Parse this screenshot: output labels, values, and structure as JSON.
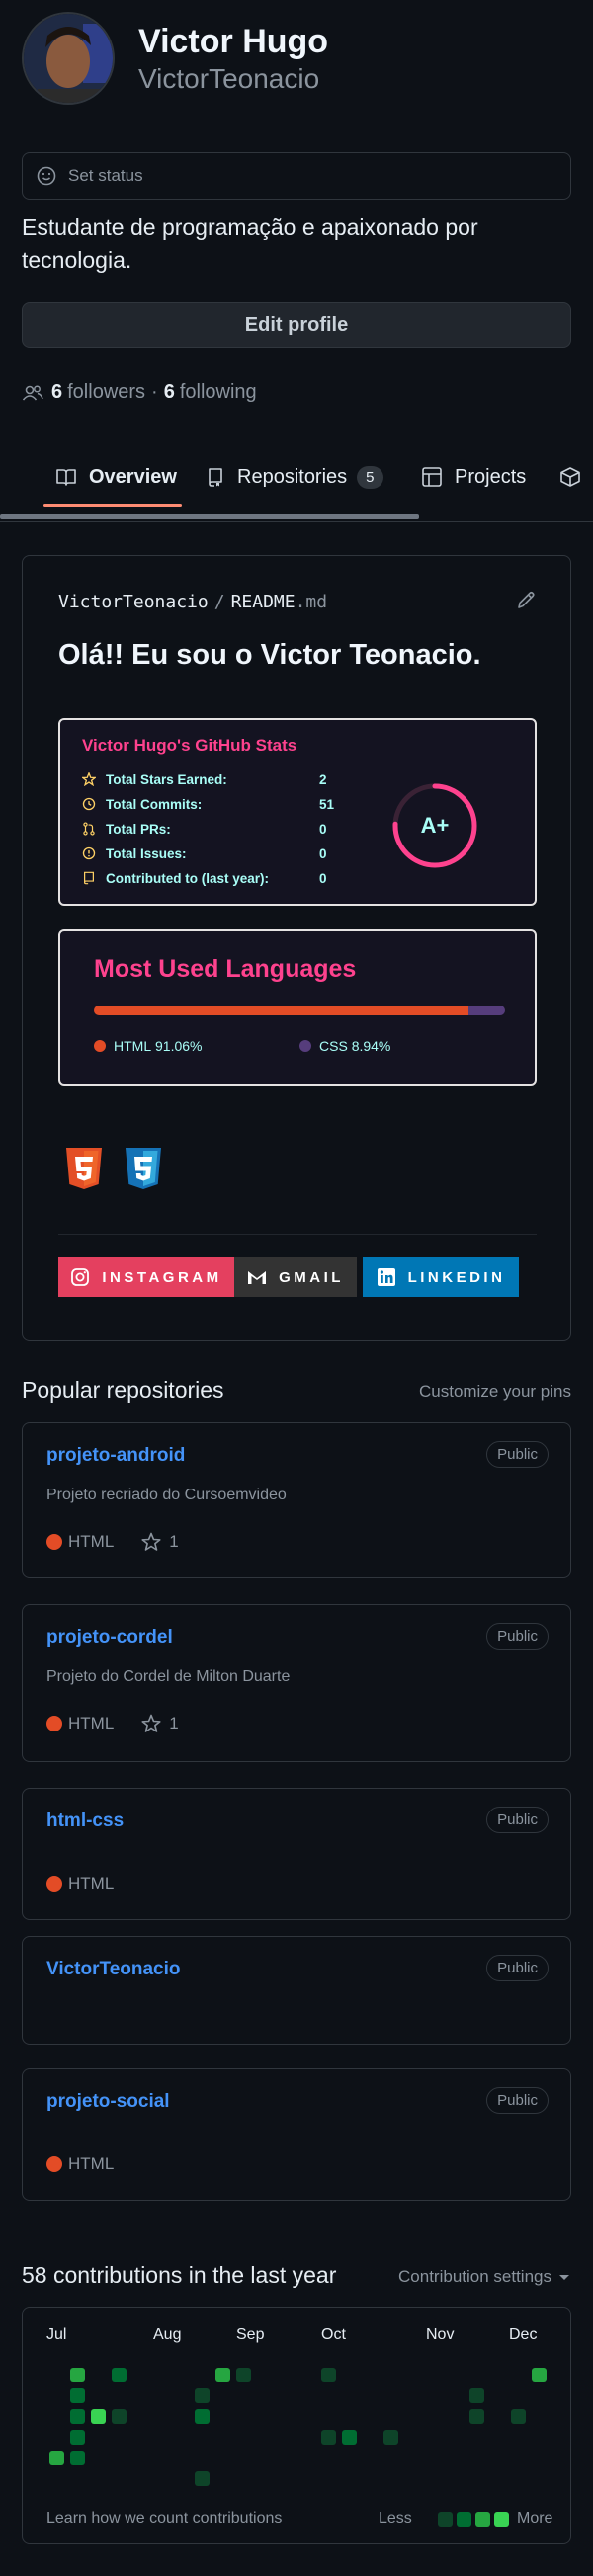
{
  "profile": {
    "fullname": "Victor Hugo",
    "login": "VictorTeonacio",
    "status_placeholder": "Set status",
    "bio": "Estudante de programação e apaixonado por tecnologia.",
    "edit_label": "Edit profile",
    "followers_count": "6",
    "followers_label": "followers",
    "separator": "·",
    "following_count": "6",
    "following_label": "following"
  },
  "tabs": [
    {
      "label": "Overview",
      "icon": "book-icon"
    },
    {
      "label": "Repositories",
      "icon": "repo-icon",
      "count": "5"
    },
    {
      "label": "Projects",
      "icon": "table-icon"
    }
  ],
  "readme": {
    "owner": "VictorTeonacio",
    "sep": "/",
    "file": "README",
    "ext": ".md",
    "heading": "Olá!! Eu sou o Victor Teonacio."
  },
  "stats_card": {
    "title": "Victor Hugo's GitHub Stats",
    "rows": [
      {
        "label": "Total Stars Earned:",
        "value": "2",
        "icon": "star-icon"
      },
      {
        "label": "Total Commits:",
        "value": "51",
        "icon": "history-icon"
      },
      {
        "label": "Total PRs:",
        "value": "0",
        "icon": "pull-request-icon"
      },
      {
        "label": "Total Issues:",
        "value": "0",
        "icon": "issue-icon"
      },
      {
        "label": "Contributed to (last year):",
        "value": "0",
        "icon": "repo-icon"
      }
    ],
    "grade": "A+",
    "colors": {
      "title": "#fe428e",
      "text": "#a9fef7",
      "ring": "#fe428e",
      "bg": "#141321"
    }
  },
  "languages_card": {
    "title": "Most Used Languages",
    "languages": [
      {
        "name": "HTML",
        "percent_label": "91.06%",
        "percent": 91.06,
        "color": "#e34c26"
      },
      {
        "name": "CSS",
        "percent_label": "8.94%",
        "percent": 8.94,
        "color": "#563d7c"
      }
    ]
  },
  "tech_icons": [
    "html5-icon",
    "css3-icon"
  ],
  "social_badges": [
    {
      "label": "INSTAGRAM",
      "icon": "instagram-icon",
      "color": "#e4405f"
    },
    {
      "label": "GMAIL",
      "icon": "gmail-icon",
      "color": "#333333"
    },
    {
      "label": "LINKEDIN",
      "icon": "linkedin-icon",
      "color": "#0077b5"
    }
  ],
  "popular": {
    "title": "Popular repositories",
    "customize": "Customize your pins",
    "repos": [
      {
        "name": "projeto-android",
        "badge": "Public",
        "desc": "Projeto recriado do Cursoemvideo",
        "lang": "HTML",
        "stars": "1"
      },
      {
        "name": "projeto-cordel",
        "badge": "Public",
        "desc": "Projeto do Cordel de Milton Duarte",
        "lang": "HTML",
        "stars": "1"
      },
      {
        "name": "html-css",
        "badge": "Public",
        "desc": "",
        "lang": "HTML",
        "stars": ""
      },
      {
        "name": "VictorTeonacio",
        "badge": "Public",
        "desc": "",
        "lang": "",
        "stars": ""
      },
      {
        "name": "projeto-social",
        "badge": "Public",
        "desc": "",
        "lang": "HTML",
        "stars": ""
      }
    ]
  },
  "contributions": {
    "title": "58 contributions in the last year",
    "settings": "Contribution settings",
    "months": [
      "Jul",
      "Aug",
      "Sep",
      "Oct",
      "Nov",
      "Dec"
    ],
    "learn": "Learn how we count contributions",
    "less": "Less",
    "more": "More",
    "colors": [
      "#0e4429",
      "#006d32",
      "#26a641",
      "#39d353"
    ]
  }
}
